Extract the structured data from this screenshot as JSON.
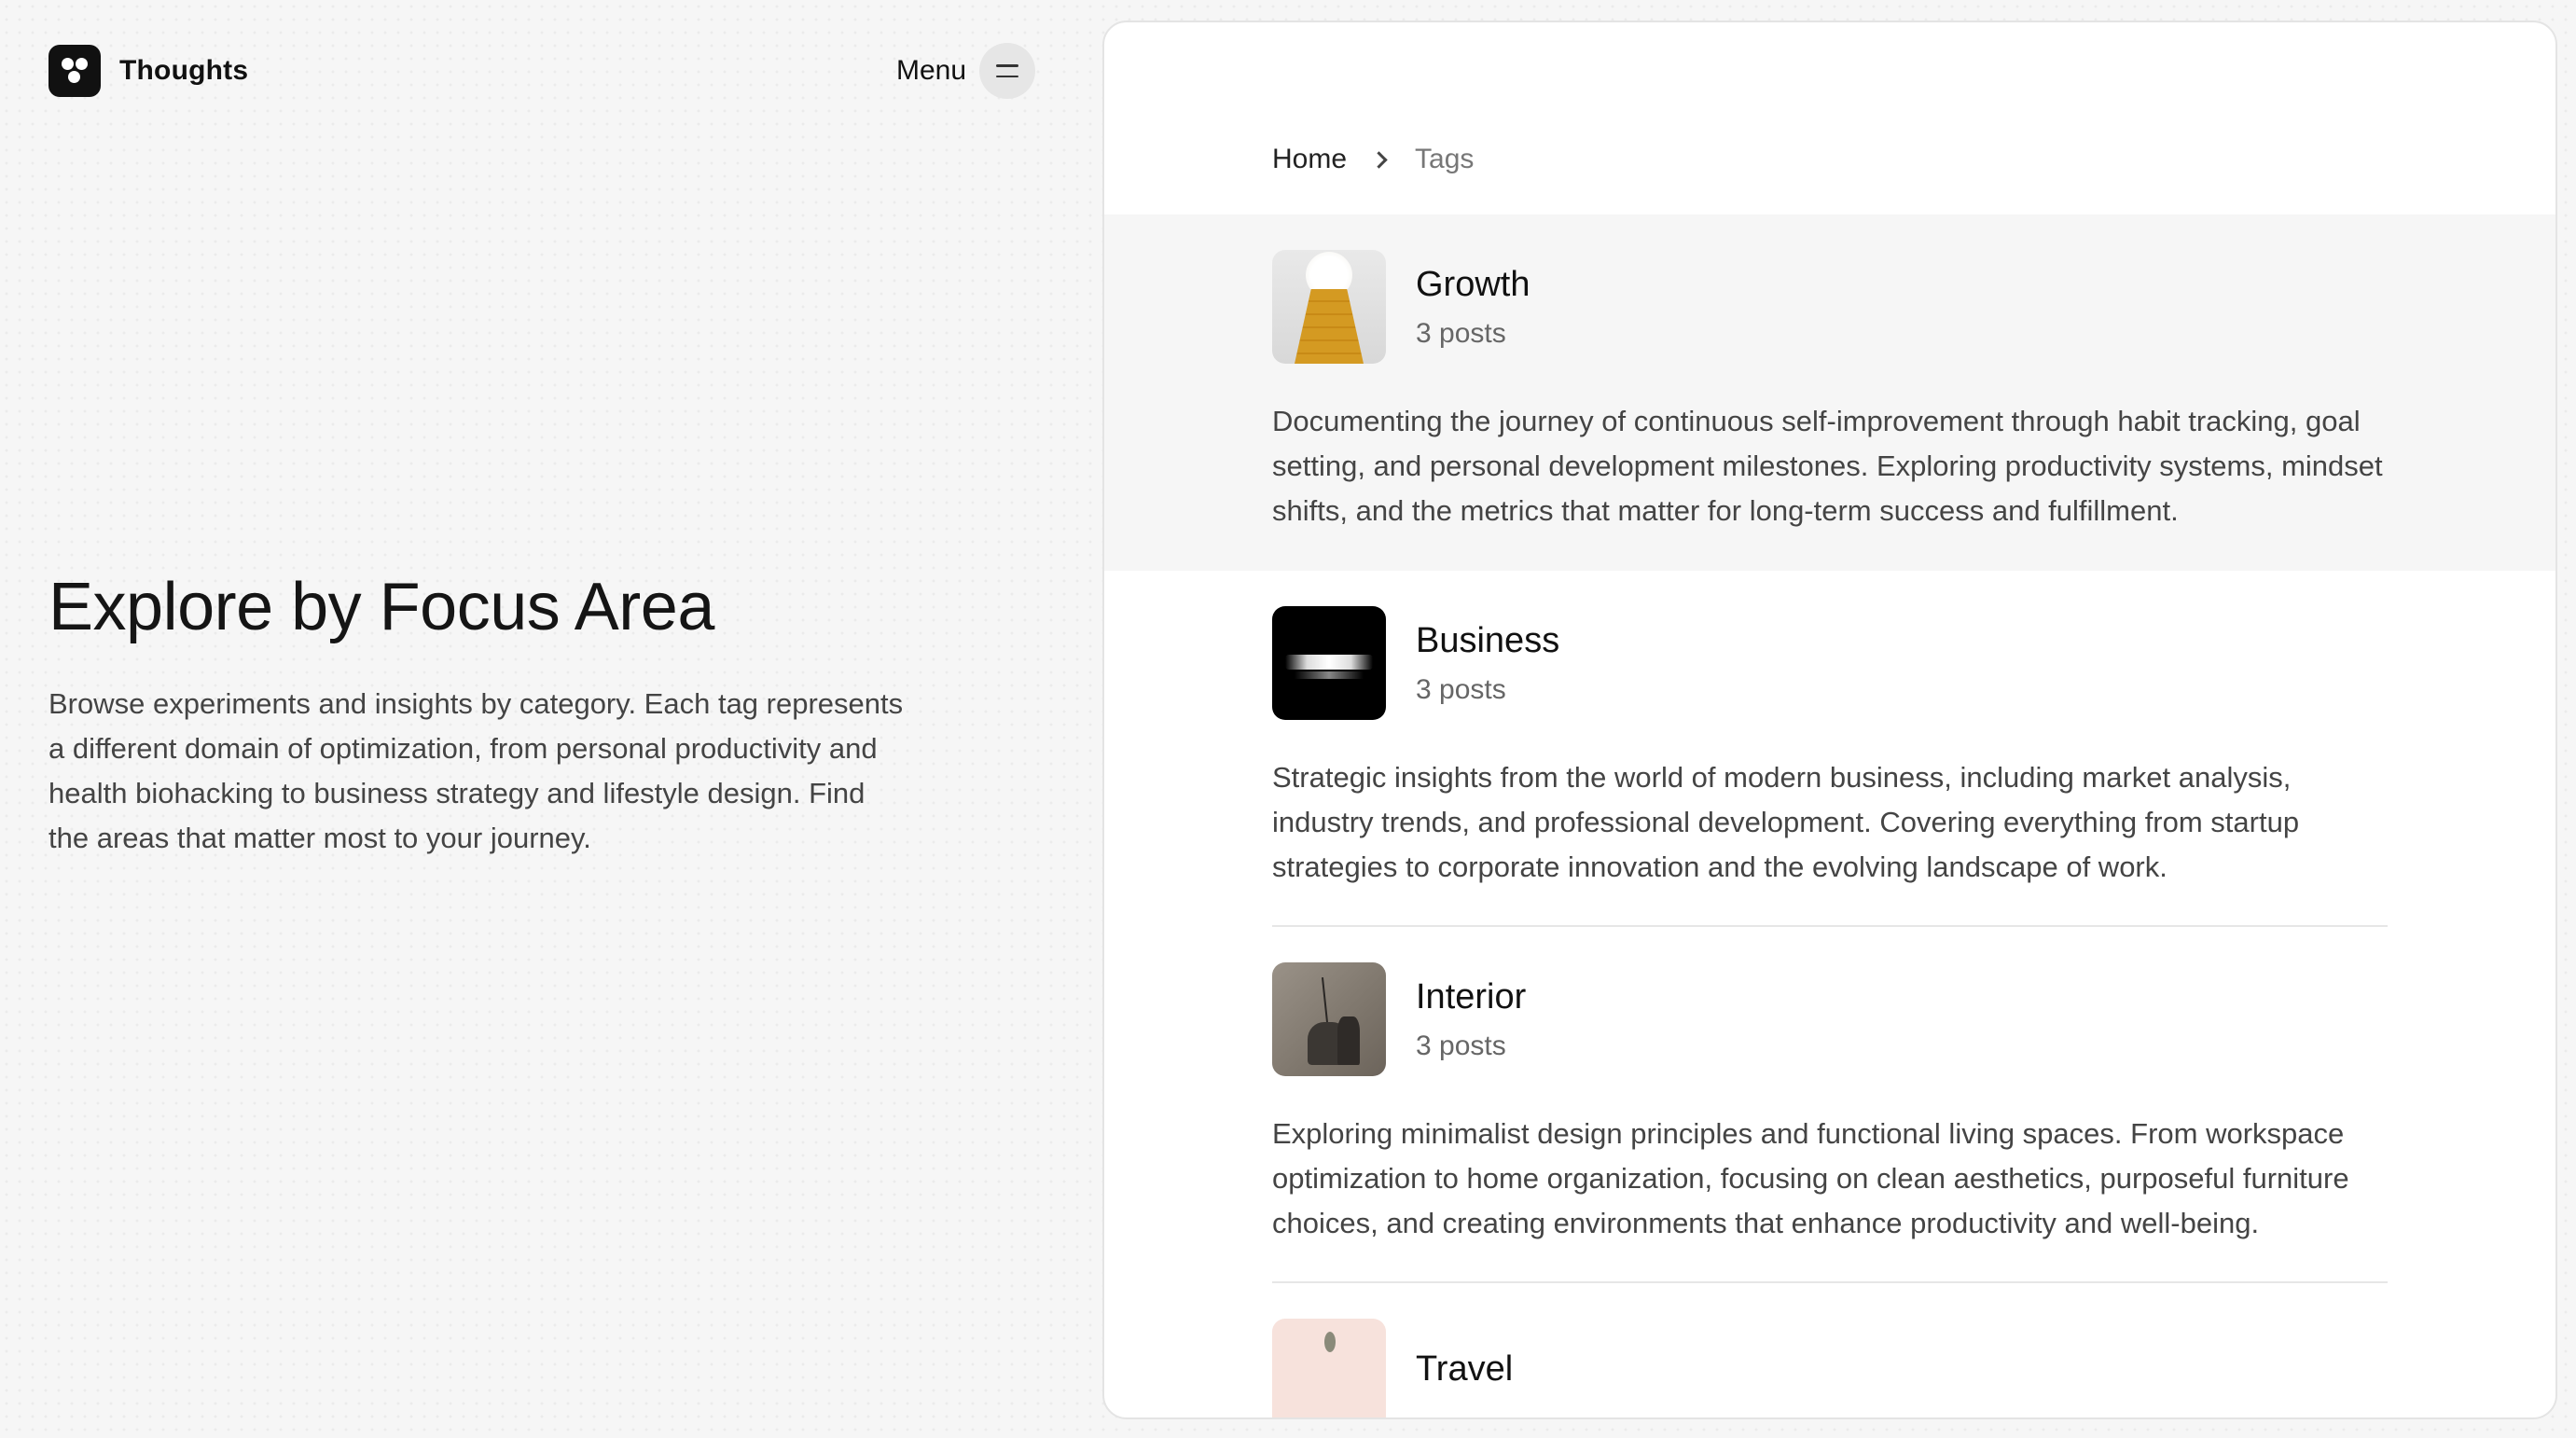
{
  "brand": {
    "name": "Thoughts",
    "logo_icon": "three-dots-logo-icon"
  },
  "menu": {
    "label": "Menu",
    "icon": "hamburger-icon"
  },
  "hero": {
    "title": "Explore by Focus Area",
    "description": "Browse experiments and insights by category. Each tag represents a different domain of optimization, from personal productivity and health biohacking to business strategy and lifestyle design. Find the areas that matter most to your journey."
  },
  "breadcrumb": {
    "home": "Home",
    "current": "Tags",
    "separator_icon": "chevron-right-icon"
  },
  "tags": [
    {
      "name": "Growth",
      "count": "3 posts",
      "description": "Documenting the journey of continuous self-improvement through habit tracking, goal setting, and personal development milestones. Exploring productivity systems, mindset shifts, and the metrics that matter for long-term success and fulfillment."
    },
    {
      "name": "Business",
      "count": "3 posts",
      "description": "Strategic insights from the world of modern business, including market analysis, industry trends, and professional development. Covering everything from startup strategies to corporate innovation and the evolving landscape of work."
    },
    {
      "name": "Interior",
      "count": "3 posts",
      "description": "Exploring minimalist design principles and functional living spaces. From workspace optimization to home organization, focusing on clean aesthetics, purposeful furniture choices, and creating environments that enhance productivity and well-being."
    },
    {
      "name": "Travel",
      "count": "",
      "description": ""
    }
  ],
  "colors": {
    "active_row_bg": "#f6f6f6",
    "page_bg": "#f6f6f6",
    "growth_stairs": "#d49a22"
  }
}
